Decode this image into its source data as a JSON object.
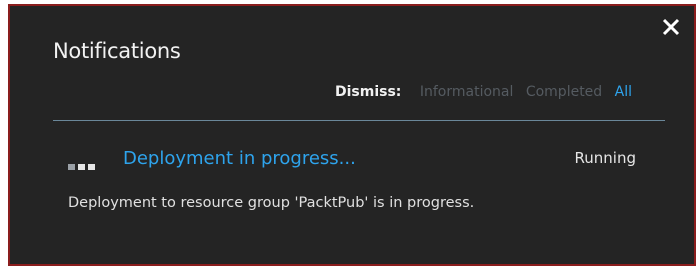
{
  "panel": {
    "title": "Notifications",
    "close_icon": "close-icon"
  },
  "dismiss": {
    "label": "Dismiss:",
    "filters": [
      "Informational",
      "Completed",
      "All"
    ],
    "active": "All"
  },
  "notification": {
    "title": "Deployment in progress...",
    "status": "Running",
    "description": "Deployment to resource group 'PacktPub' is in progress.",
    "icon": "progress-dots-icon"
  },
  "colors": {
    "background": "#242424",
    "accent": "#2ea4ed",
    "muted": "#555b61",
    "border": "#8a1d1d"
  }
}
